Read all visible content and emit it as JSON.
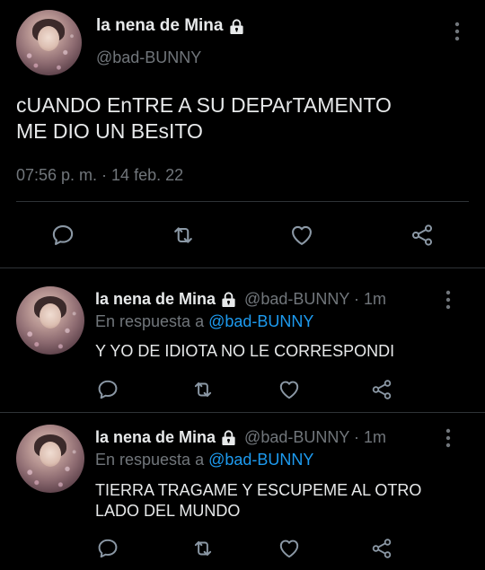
{
  "main_tweet": {
    "name": "la nena de Mina",
    "handle": "@bad-BUNNY",
    "text_lines": [
      "cUANDO EnTRE A SU DEPArTAMENTO",
      "ME DIO UN BEsITO"
    ],
    "timestamp": "07:56 p. m. · 14 feb. 22"
  },
  "replies": [
    {
      "name": "la nena de Mina",
      "handle_time": "@bad-BUNNY · 1m",
      "reply_prefix": "En respuesta a",
      "reply_to": "@bad-BUNNY",
      "text_lines": [
        "Y YO DE IDIOTA NO LE CORRESPONDI"
      ]
    },
    {
      "name": "la nena de Mina",
      "handle_time": "@bad-BUNNY · 1m",
      "reply_prefix": "En respuesta a",
      "reply_to": "@bad-BUNNY",
      "text_lines": [
        "TIERRA TRAGAME Y ESCUPEME AL OTRO",
        "LADO DEL MUNDO"
      ]
    }
  ],
  "icons": {
    "lock": "lock-icon",
    "more": "more-vertical-icon",
    "reply": "reply-icon",
    "retweet": "retweet-icon",
    "like": "heart-icon",
    "share": "share-icon"
  },
  "colors": {
    "background": "#000000",
    "text": "#e7e9ea",
    "muted": "#71767b",
    "link": "#1d9bf0",
    "divider": "#2f3336"
  }
}
